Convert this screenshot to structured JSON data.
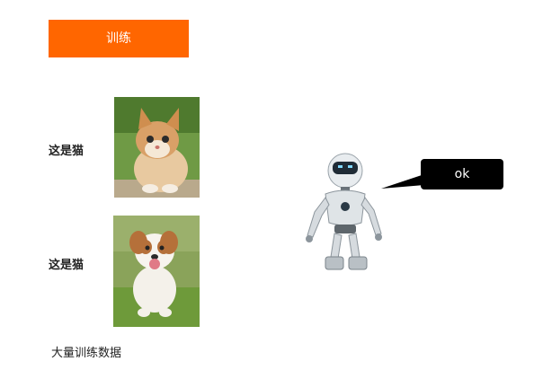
{
  "toolbar": {
    "train_label": "训练"
  },
  "samples": [
    {
      "label": "这是猫",
      "image": "cat-photo"
    },
    {
      "label": "这是猫",
      "image": "dog-photo"
    }
  ],
  "caption": "大量训练数据",
  "robot": {
    "image": "robot-illustration",
    "reply": "ok"
  },
  "colors": {
    "accent": "#ff6600",
    "bubble": "#000000"
  }
}
